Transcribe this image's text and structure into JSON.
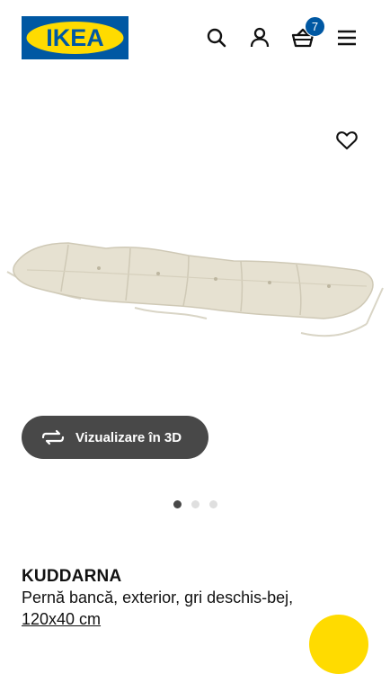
{
  "header": {
    "logo_text": "IKEA",
    "cart_count": "7",
    "icons": [
      "search-icon",
      "account-icon",
      "cart-icon",
      "menu-icon"
    ]
  },
  "product": {
    "name": "KUDDARNA",
    "description": "Pernă bancă, exterior, gri deschis-bej,",
    "size": "120x40 cm"
  },
  "gallery": {
    "view_3d_label": "Vizualizare în 3D",
    "total_images": 3,
    "active_index": 0
  },
  "colors": {
    "brand_blue": "#0058a3",
    "brand_yellow": "#ffdb00",
    "button_dark": "#484848"
  }
}
